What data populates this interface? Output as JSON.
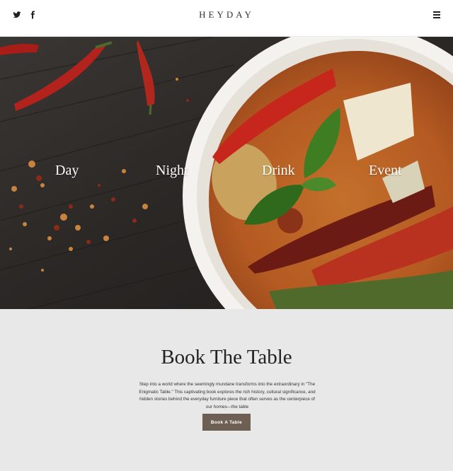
{
  "header": {
    "brand": "HEYDAY",
    "social": [
      {
        "icon": "twitter-icon"
      },
      {
        "icon": "facebook-icon"
      }
    ],
    "menu_icon": "hamburger-menu-icon"
  },
  "hero": {
    "nav": [
      {
        "label": "Day"
      },
      {
        "label": "Night"
      },
      {
        "label": "Drink"
      },
      {
        "label": "Event"
      }
    ],
    "image": "food-bowl-photo"
  },
  "booking": {
    "title": "Book The Table",
    "description": "Step into a world where the seemingly mundane transforms into the extraordinary in \"The Enigmatic Table.\" This captivating book explores the rich history, cultural significance, and hidden stories behind the everyday furniture piece that often serves as the centerpiece of our homes—the table",
    "button_label": "Book A Table"
  },
  "colors": {
    "header_bg": "#ffffff",
    "section_bg": "#e8e8e8",
    "button_bg": "#6d5f52"
  }
}
